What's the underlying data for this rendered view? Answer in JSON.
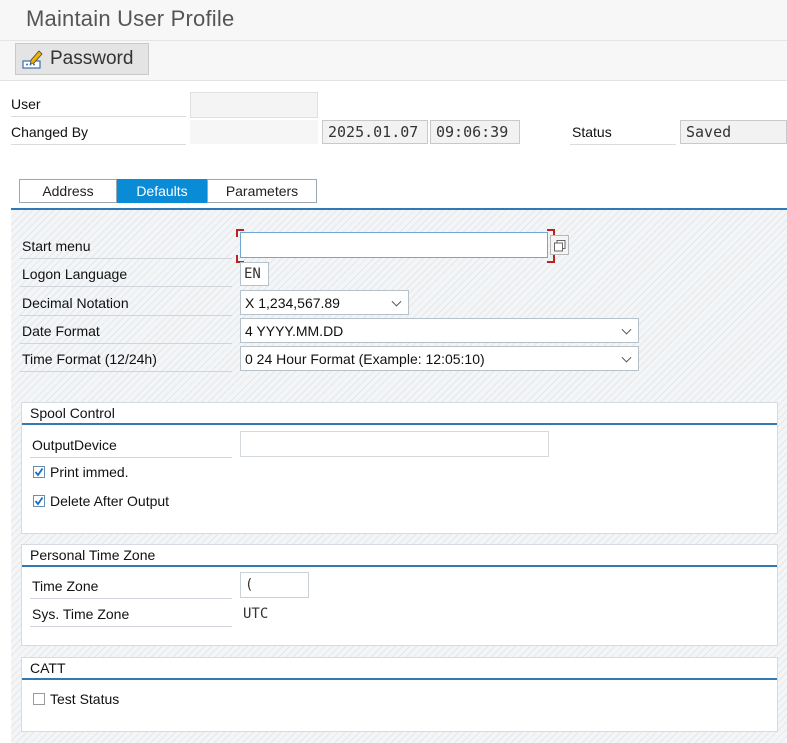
{
  "window": {
    "title": "Maintain User Profile"
  },
  "toolbar": {
    "password_label": "Password"
  },
  "header": {
    "user_label": "User",
    "changed_by_label": "Changed By",
    "changed_date": "2025.01.07",
    "changed_time": "09:06:39",
    "status_label": "Status",
    "status_value": "Saved"
  },
  "tabs": [
    {
      "label": "Address",
      "active": false
    },
    {
      "label": "Defaults",
      "active": true
    },
    {
      "label": "Parameters",
      "active": false
    }
  ],
  "defaults": {
    "start_menu_label": "Start menu",
    "start_menu_value": "",
    "logon_language_label": "Logon Language",
    "logon_language_value": "EN",
    "decimal_notation_label": "Decimal Notation",
    "decimal_notation_value": "X 1,234,567.89",
    "date_format_label": "Date Format",
    "date_format_value": "4 YYYY.MM.DD",
    "time_format_label": "Time Format (12/24h)",
    "time_format_value": "0 24 Hour Format (Example: 12:05:10)"
  },
  "spool": {
    "title": "Spool Control",
    "output_device_label": "OutputDevice",
    "output_device_value": "",
    "print_immed_label": "Print immed.",
    "print_immed_checked": true,
    "delete_after_output_label": "Delete After Output",
    "delete_after_output_checked": true
  },
  "timezone": {
    "title": "Personal Time Zone",
    "time_zone_label": "Time Zone",
    "time_zone_value": "(",
    "sys_time_zone_label": "Sys. Time Zone",
    "sys_time_zone_value": "UTC"
  },
  "catt": {
    "title": "CATT",
    "test_status_label": "Test Status",
    "test_status_checked": false
  },
  "colors": {
    "accent": "#0a8bd6",
    "group_line": "#2f7ab4"
  }
}
